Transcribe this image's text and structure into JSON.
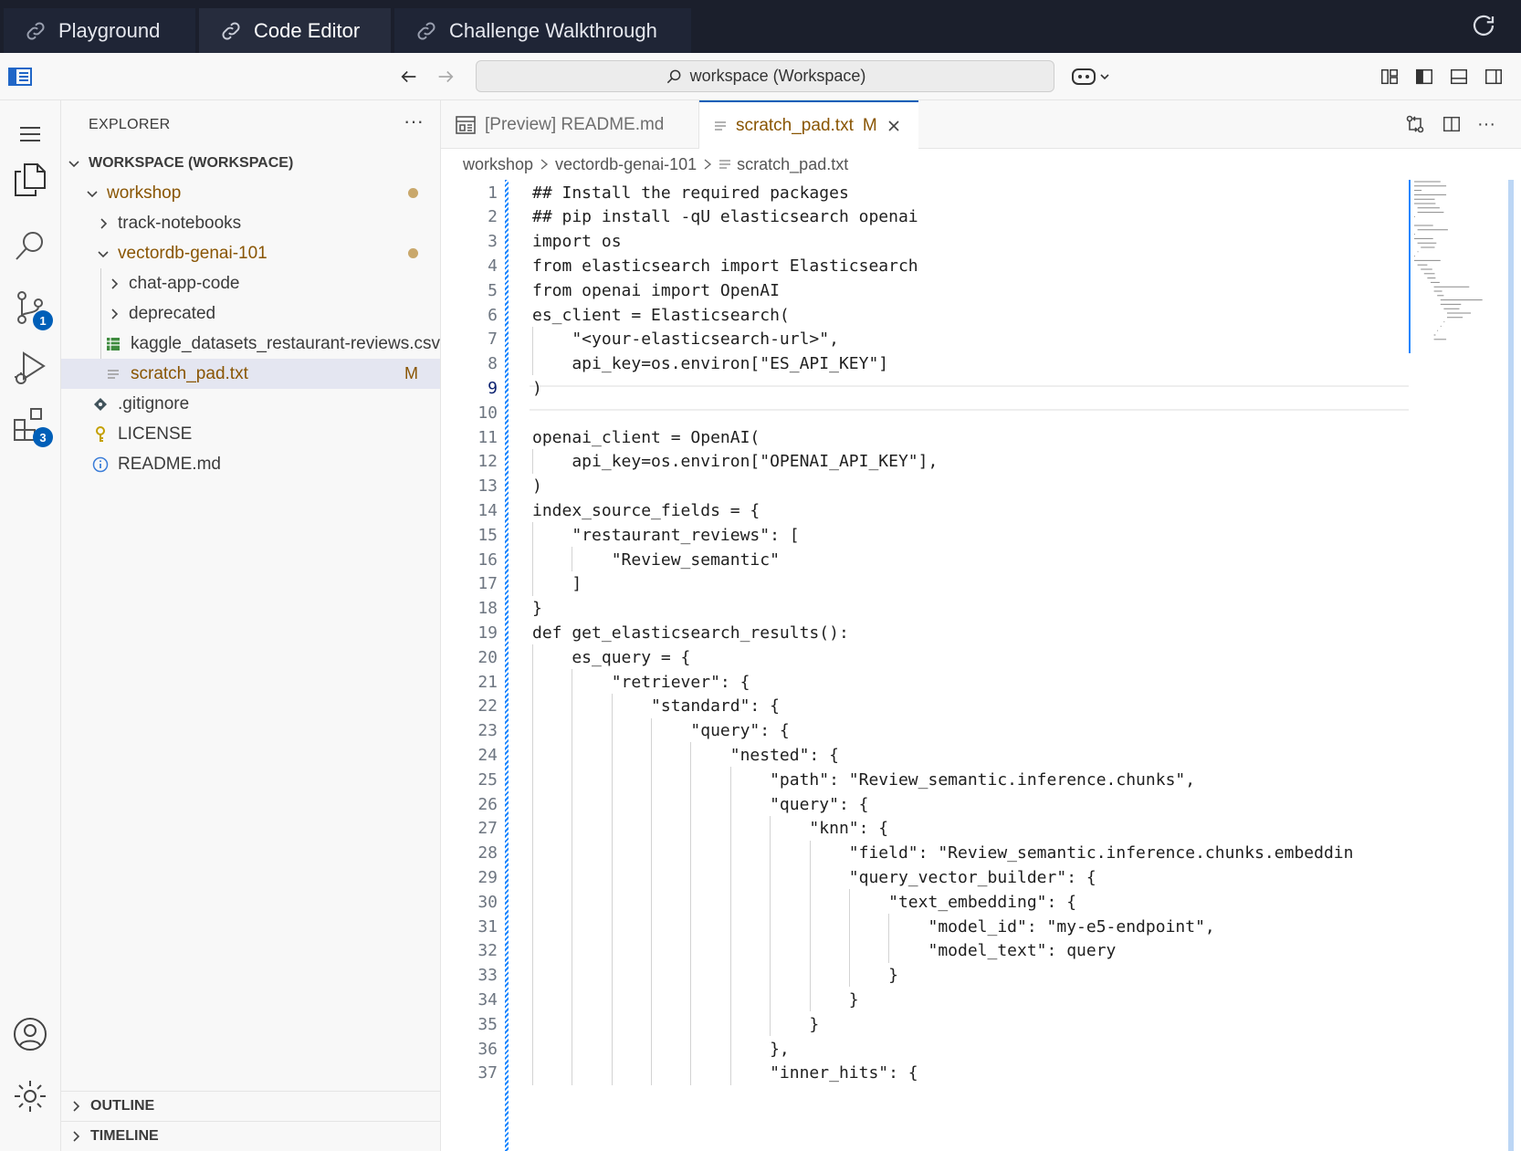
{
  "top_tabs": [
    {
      "label": "Playground"
    },
    {
      "label": "Code Editor"
    },
    {
      "label": "Challenge Walkthrough"
    }
  ],
  "command_center": {
    "label": "workspace (Workspace)"
  },
  "activity_bar": {
    "source_control_badge": "1",
    "extensions_badge": "3"
  },
  "explorer": {
    "title": "EXPLORER",
    "workspace_label": "WORKSPACE (WORKSPACE)",
    "items": [
      {
        "label": "workshop"
      },
      {
        "label": "track-notebooks"
      },
      {
        "label": "vectordb-genai-101"
      },
      {
        "label": "chat-app-code"
      },
      {
        "label": "deprecated"
      },
      {
        "label": "kaggle_datasets_restaurant-reviews.csv"
      },
      {
        "label": "scratch_pad.txt",
        "flag": "M"
      },
      {
        "label": ".gitignore"
      },
      {
        "label": "LICENSE"
      },
      {
        "label": "README.md"
      }
    ],
    "outline_label": "OUTLINE",
    "timeline_label": "TIMELINE"
  },
  "editor": {
    "tabs": [
      {
        "label": "[Preview] README.md"
      },
      {
        "label": "scratch_pad.txt",
        "flag": "M"
      }
    ],
    "breadcrumb": [
      "workshop",
      "vectordb-genai-101",
      "scratch_pad.txt"
    ],
    "current_line": 9,
    "lines": [
      "## Install the required packages",
      "## pip install -qU elasticsearch openai",
      "import os",
      "from elasticsearch import Elasticsearch",
      "from openai import OpenAI",
      "es_client = Elasticsearch(",
      "    \"<your-elasticsearch-url>\",",
      "    api_key=os.environ[\"ES_API_KEY\"]",
      ")",
      "",
      "openai_client = OpenAI(",
      "    api_key=os.environ[\"OPENAI_API_KEY\"],",
      ")",
      "index_source_fields = {",
      "    \"restaurant_reviews\": [",
      "        \"Review_semantic\"",
      "    ]",
      "}",
      "def get_elasticsearch_results():",
      "    es_query = {",
      "        \"retriever\": {",
      "            \"standard\": {",
      "                \"query\": {",
      "                    \"nested\": {",
      "                        \"path\": \"Review_semantic.inference.chunks\",",
      "                        \"query\": {",
      "                            \"knn\": {",
      "                                \"field\": \"Review_semantic.inference.chunks.embeddin",
      "                                \"query_vector_builder\": {",
      "                                    \"text_embedding\": {",
      "                                        \"model_id\": \"my-e5-endpoint\",",
      "                                        \"model_text\": query",
      "                                    }",
      "                                }",
      "                            }",
      "                        },",
      "                        \"inner_hits\": {"
    ]
  }
}
